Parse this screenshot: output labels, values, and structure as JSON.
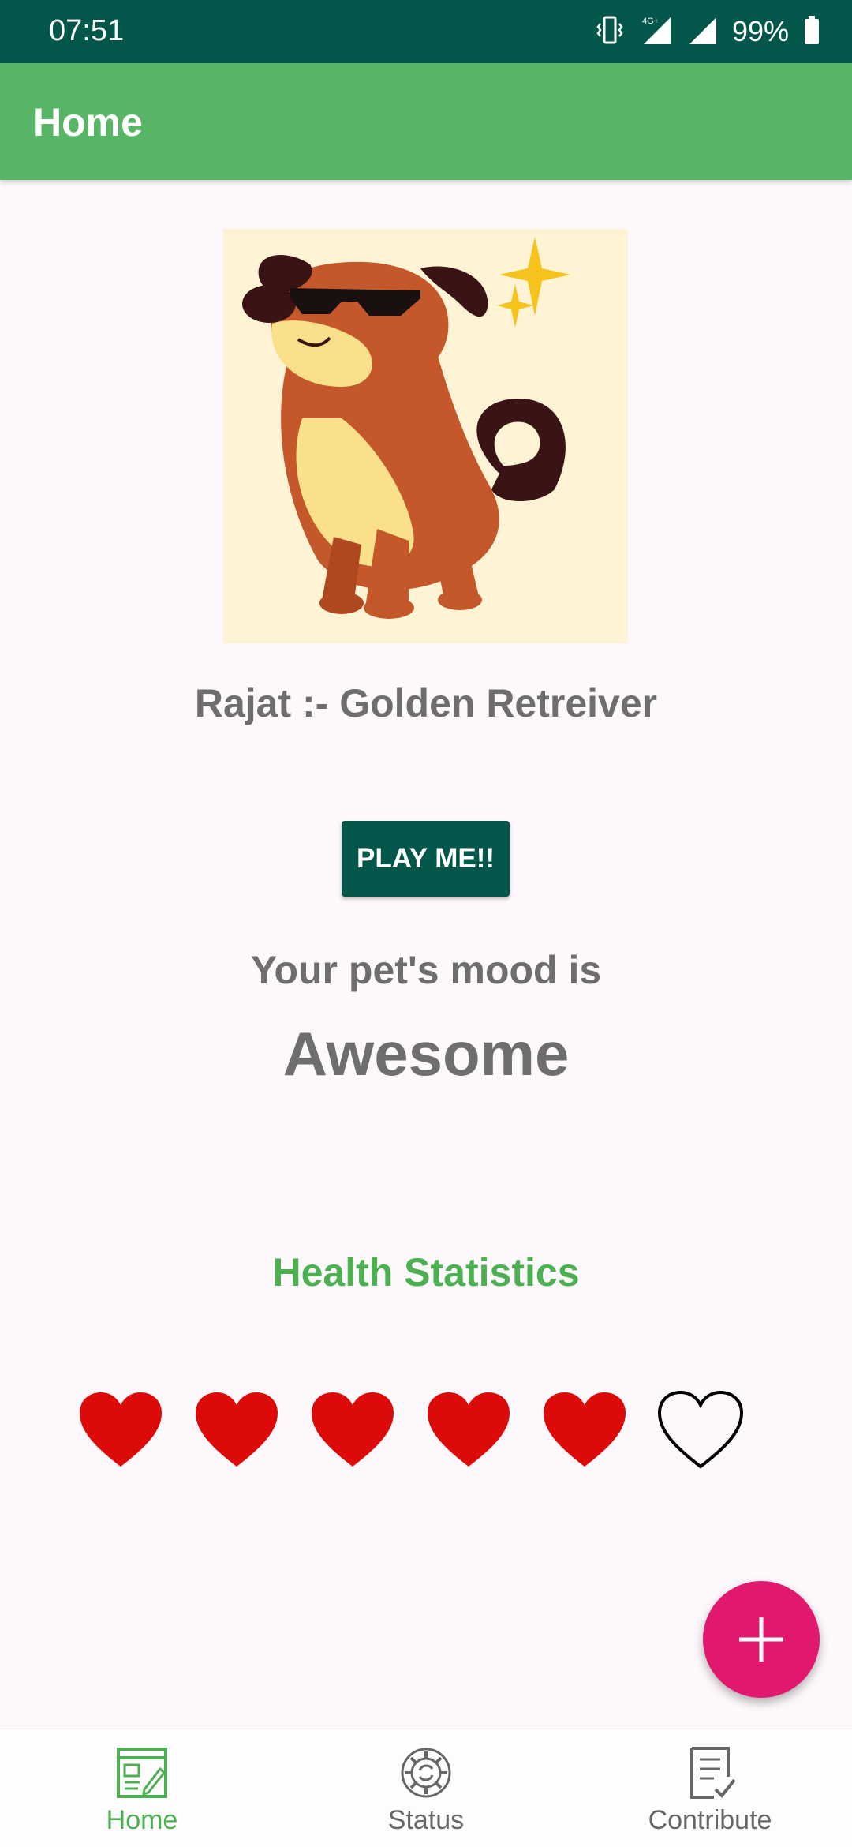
{
  "status_bar": {
    "time": "07:51",
    "network_badge": "4G+",
    "battery": "99%",
    "icons": [
      "vibrate-icon",
      "signal-4g-icon",
      "signal-icon",
      "battery-icon"
    ]
  },
  "app_bar": {
    "title": "Home"
  },
  "pet": {
    "image_icon": "dog-with-sunglasses-illustration",
    "name_line": "Rajat :- Golden Retreiver"
  },
  "play_button": {
    "label": "PLAY ME!!"
  },
  "mood": {
    "label": "Your pet's mood is",
    "value": "Awesome"
  },
  "health": {
    "title": "Health Statistics",
    "filled": 5,
    "total": 6,
    "filled_color": "#dd0a0a",
    "empty_color": "#000000"
  },
  "fab": {
    "icon": "plus-icon",
    "color": "#e2186e"
  },
  "bottom_nav": {
    "items": [
      {
        "label": "Home",
        "icon": "home-dashboard-icon",
        "active": true
      },
      {
        "label": "Status",
        "icon": "status-gear-icon",
        "active": false
      },
      {
        "label": "Contribute",
        "icon": "contribute-checklist-icon",
        "active": false
      }
    ]
  },
  "colors": {
    "status_bar": "#03574a",
    "app_bar": "#58b566",
    "accent_green": "#4caf50",
    "button": "#03574a"
  }
}
